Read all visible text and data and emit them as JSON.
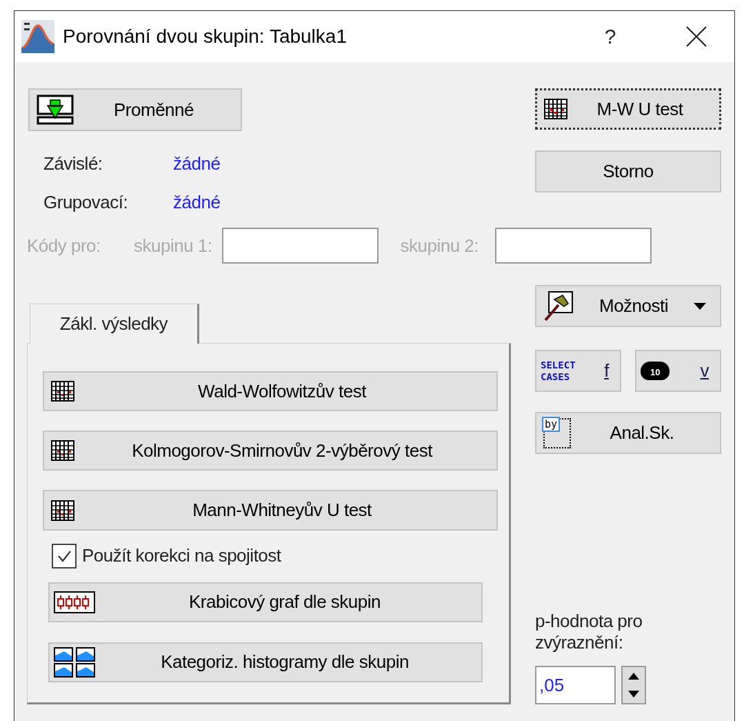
{
  "window": {
    "title": "Porovnání dvou skupin: Tabulka1",
    "help": "?"
  },
  "variables_button": "Proměnné",
  "selections": [
    {
      "label": "Závislé:",
      "value": "žádné"
    },
    {
      "label": "Grupovací:",
      "value": "žádné"
    }
  ],
  "codes": {
    "label": "Kódy pro:",
    "disabled": true,
    "fields": [
      {
        "label": "skupinu 1:"
      },
      {
        "label": "skupinu 2:"
      }
    ]
  },
  "actions": {
    "ok": {
      "label": "M-W U test",
      "focused": true
    },
    "cancel": {
      "label": "Storno",
      "focused": false
    },
    "options": {
      "label": "Možnosti"
    },
    "select_cases": {
      "icon_text": "SELECT CASES",
      "label": "f"
    },
    "weights": {
      "icon_text": "10",
      "label": "v"
    },
    "by_group": {
      "icon_text": "by",
      "label": "Anal.Sk."
    }
  },
  "tabs": [
    {
      "label": "Zákl. výsledky",
      "selected": true
    }
  ],
  "results": [
    {
      "kind": "grid",
      "label": "Wald-Wolfowitzův test"
    },
    {
      "kind": "grid",
      "label": "Kolmogorov-Smirnovův 2-výběrový test"
    },
    {
      "kind": "grid",
      "label": "Mann-Whitneyův U test"
    },
    {
      "kind": "checkbox",
      "label": "Použít korekci na spojitost",
      "checked": true
    },
    {
      "kind": "boxplot",
      "label": "Krabicový graf dle skupin"
    },
    {
      "kind": "histogram",
      "label": "Kategoriz. histogramy dle skupin"
    }
  ],
  "p_value": {
    "label": "p-hodnota pro zvýraznění:",
    "value": ",05"
  }
}
